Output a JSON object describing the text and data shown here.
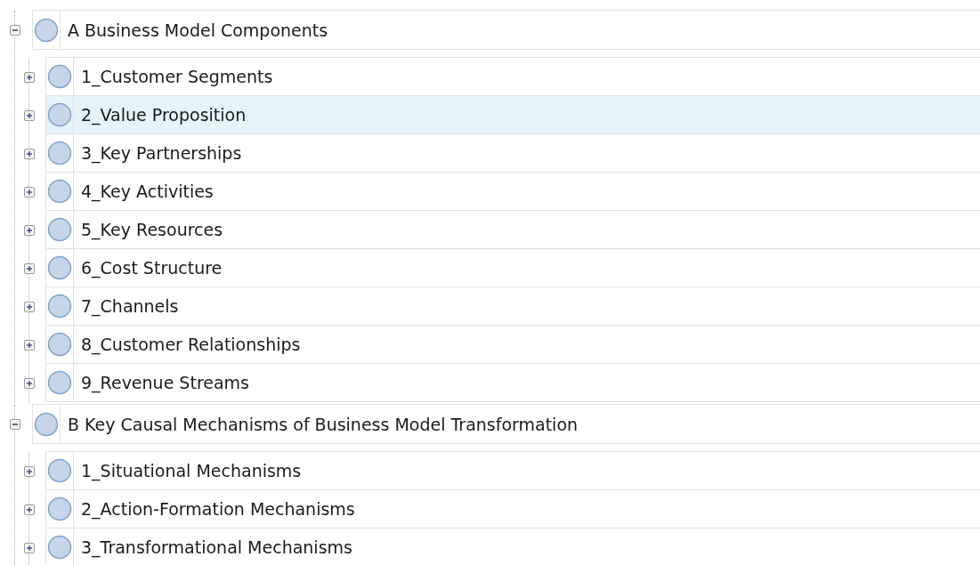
{
  "tree": [
    {
      "label": "A Business Model Components",
      "expanded": true,
      "selected": false,
      "children": [
        {
          "label": "1_Customer Segments",
          "expanded": false,
          "selected": false
        },
        {
          "label": "2_Value Proposition",
          "expanded": false,
          "selected": true
        },
        {
          "label": "3_Key Partnerships",
          "expanded": false,
          "selected": false
        },
        {
          "label": "4_Key Activities",
          "expanded": false,
          "selected": false
        },
        {
          "label": "5_Key Resources",
          "expanded": false,
          "selected": false
        },
        {
          "label": "6_Cost Structure",
          "expanded": false,
          "selected": false
        },
        {
          "label": "7_Channels",
          "expanded": false,
          "selected": false
        },
        {
          "label": "8_Customer Relationships",
          "expanded": false,
          "selected": false
        },
        {
          "label": "9_Revenue Streams",
          "expanded": false,
          "selected": false
        }
      ]
    },
    {
      "label": "B Key Causal Mechanisms of Business Model Transformation",
      "expanded": true,
      "selected": false,
      "children": [
        {
          "label": "1_Situational Mechanisms",
          "expanded": false,
          "selected": false
        },
        {
          "label": "2_Action-Formation Mechanisms",
          "expanded": false,
          "selected": false
        },
        {
          "label": "3_Transformational Mechanisms",
          "expanded": false,
          "selected": false
        }
      ]
    }
  ]
}
